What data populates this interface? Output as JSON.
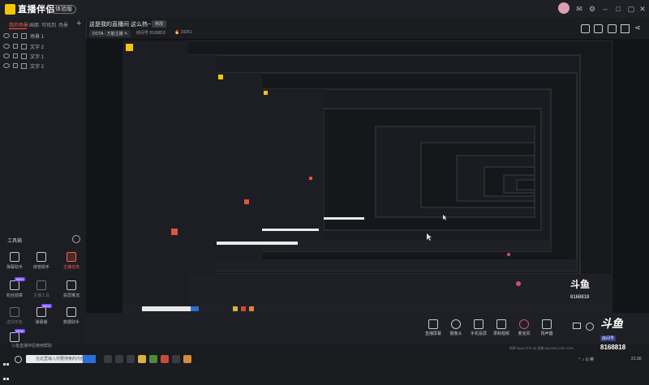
{
  "app": {
    "name": "直播伴侣",
    "beta": "体验版"
  },
  "window_buttons": [
    "minimize-icon",
    "restore-icon",
    "maximize-icon",
    "close-icon"
  ],
  "left": {
    "tabs": [
      "我的场景",
      "画面",
      "可找到",
      "场景"
    ],
    "scenes": [
      {
        "label": "场景 1",
        "icon": "eye-icon"
      },
      {
        "label": "文字 2",
        "icon": "eye-icon"
      },
      {
        "label": "文字 1",
        "icon": "eye-icon"
      },
      {
        "label": "文字 2",
        "icon": "eye-icon"
      }
    ],
    "tools_title": "工具箱",
    "tools": [
      {
        "label": "弹幕助手",
        "badge": "",
        "state": "normal"
      },
      {
        "label": "房管助手",
        "badge": "",
        "state": "normal"
      },
      {
        "label": "主播任务",
        "badge": "",
        "state": "active"
      },
      {
        "label": "粉丝勋章",
        "badge": "NEW",
        "state": "normal"
      },
      {
        "label": "主播工具",
        "badge": "",
        "state": "dim"
      },
      {
        "label": "投屏推流",
        "badge": "",
        "state": "normal"
      },
      {
        "label": "虚拟形象",
        "badge": "",
        "state": "dim"
      },
      {
        "label": "弹幕播",
        "badge": "NEW",
        "state": "normal"
      },
      {
        "label": "数据助手",
        "badge": "",
        "state": "normal"
      },
      {
        "label": "投屏",
        "badge": "NEW",
        "state": "normal"
      }
    ],
    "help_link": "斗鱼直播伴侣使用帮助"
  },
  "room": {
    "title": "这是我的直播间 这么热~",
    "edit": "修改",
    "game_tag": "DOTA · 万能主播 ✎",
    "room_id": "房间号 8168818",
    "hot": "🔥 19261"
  },
  "bottom_tools": [
    "直播屏幕",
    "摄像头",
    "手机投屏",
    "录制视频",
    "麦克风",
    "扬声器"
  ],
  "stats": "码率 0kb/s  FPS 30  丢帧 0(0.00%)  CPU 12%",
  "watermark": {
    "logo": "斗鱼",
    "sub": "房间号",
    "room": "8168818"
  },
  "taskbar": {
    "search_placeholder": "在这里输入你要搜索的内容",
    "time": "21:30"
  }
}
